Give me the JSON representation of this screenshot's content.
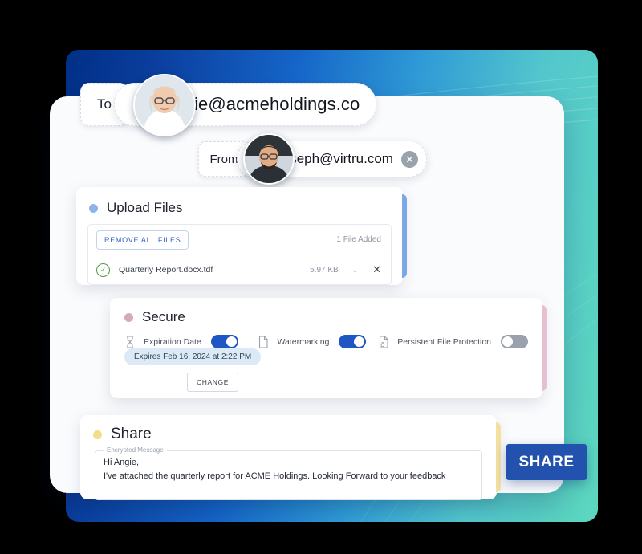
{
  "recipients": {
    "to": {
      "label": "To",
      "email": "angie@acmeholdings.co",
      "avatar": "woman-avatar"
    },
    "from": {
      "label": "From",
      "email": "joseph@virtru.com",
      "avatar": "man-avatar",
      "remove_icon": "close-icon"
    }
  },
  "upload": {
    "title": "Upload Files",
    "dot_color": "#8cb4ea",
    "stripe_color": "#7aa7e8",
    "remove_all_label": "REMOVE ALL FILES",
    "files_added": "1 File Added",
    "files": [
      {
        "name": "Quarterly Report.docx.tdf",
        "size": "5.97 KB",
        "status_icon": "check-circle-icon"
      }
    ]
  },
  "secure": {
    "title": "Secure",
    "dot_color": "#d5aabd",
    "stripe_color": "#e8bfd2",
    "options": [
      {
        "label": "Expiration Date",
        "icon": "hourglass-icon",
        "state": "on"
      },
      {
        "label": "Watermarking",
        "icon": "document-icon",
        "state": "on"
      },
      {
        "label": "Persistent File Protection",
        "icon": "document-lock-icon",
        "state": "off"
      }
    ],
    "expires_text": "Expires Feb 16, 2024 at 2:22 PM",
    "change_label": "CHANGE"
  },
  "share": {
    "title": "Share",
    "dot_color": "#f2de8a",
    "stripe_color": "#f3dfa0",
    "message_legend": "Encrypted Message",
    "message_line_1": "Hi Angie,",
    "message_line_2": "I've attached the quarterly report for ACME Holdings. Looking Forward to your feedback",
    "share_button": "SHARE",
    "share_button_color": "#2352ae"
  }
}
